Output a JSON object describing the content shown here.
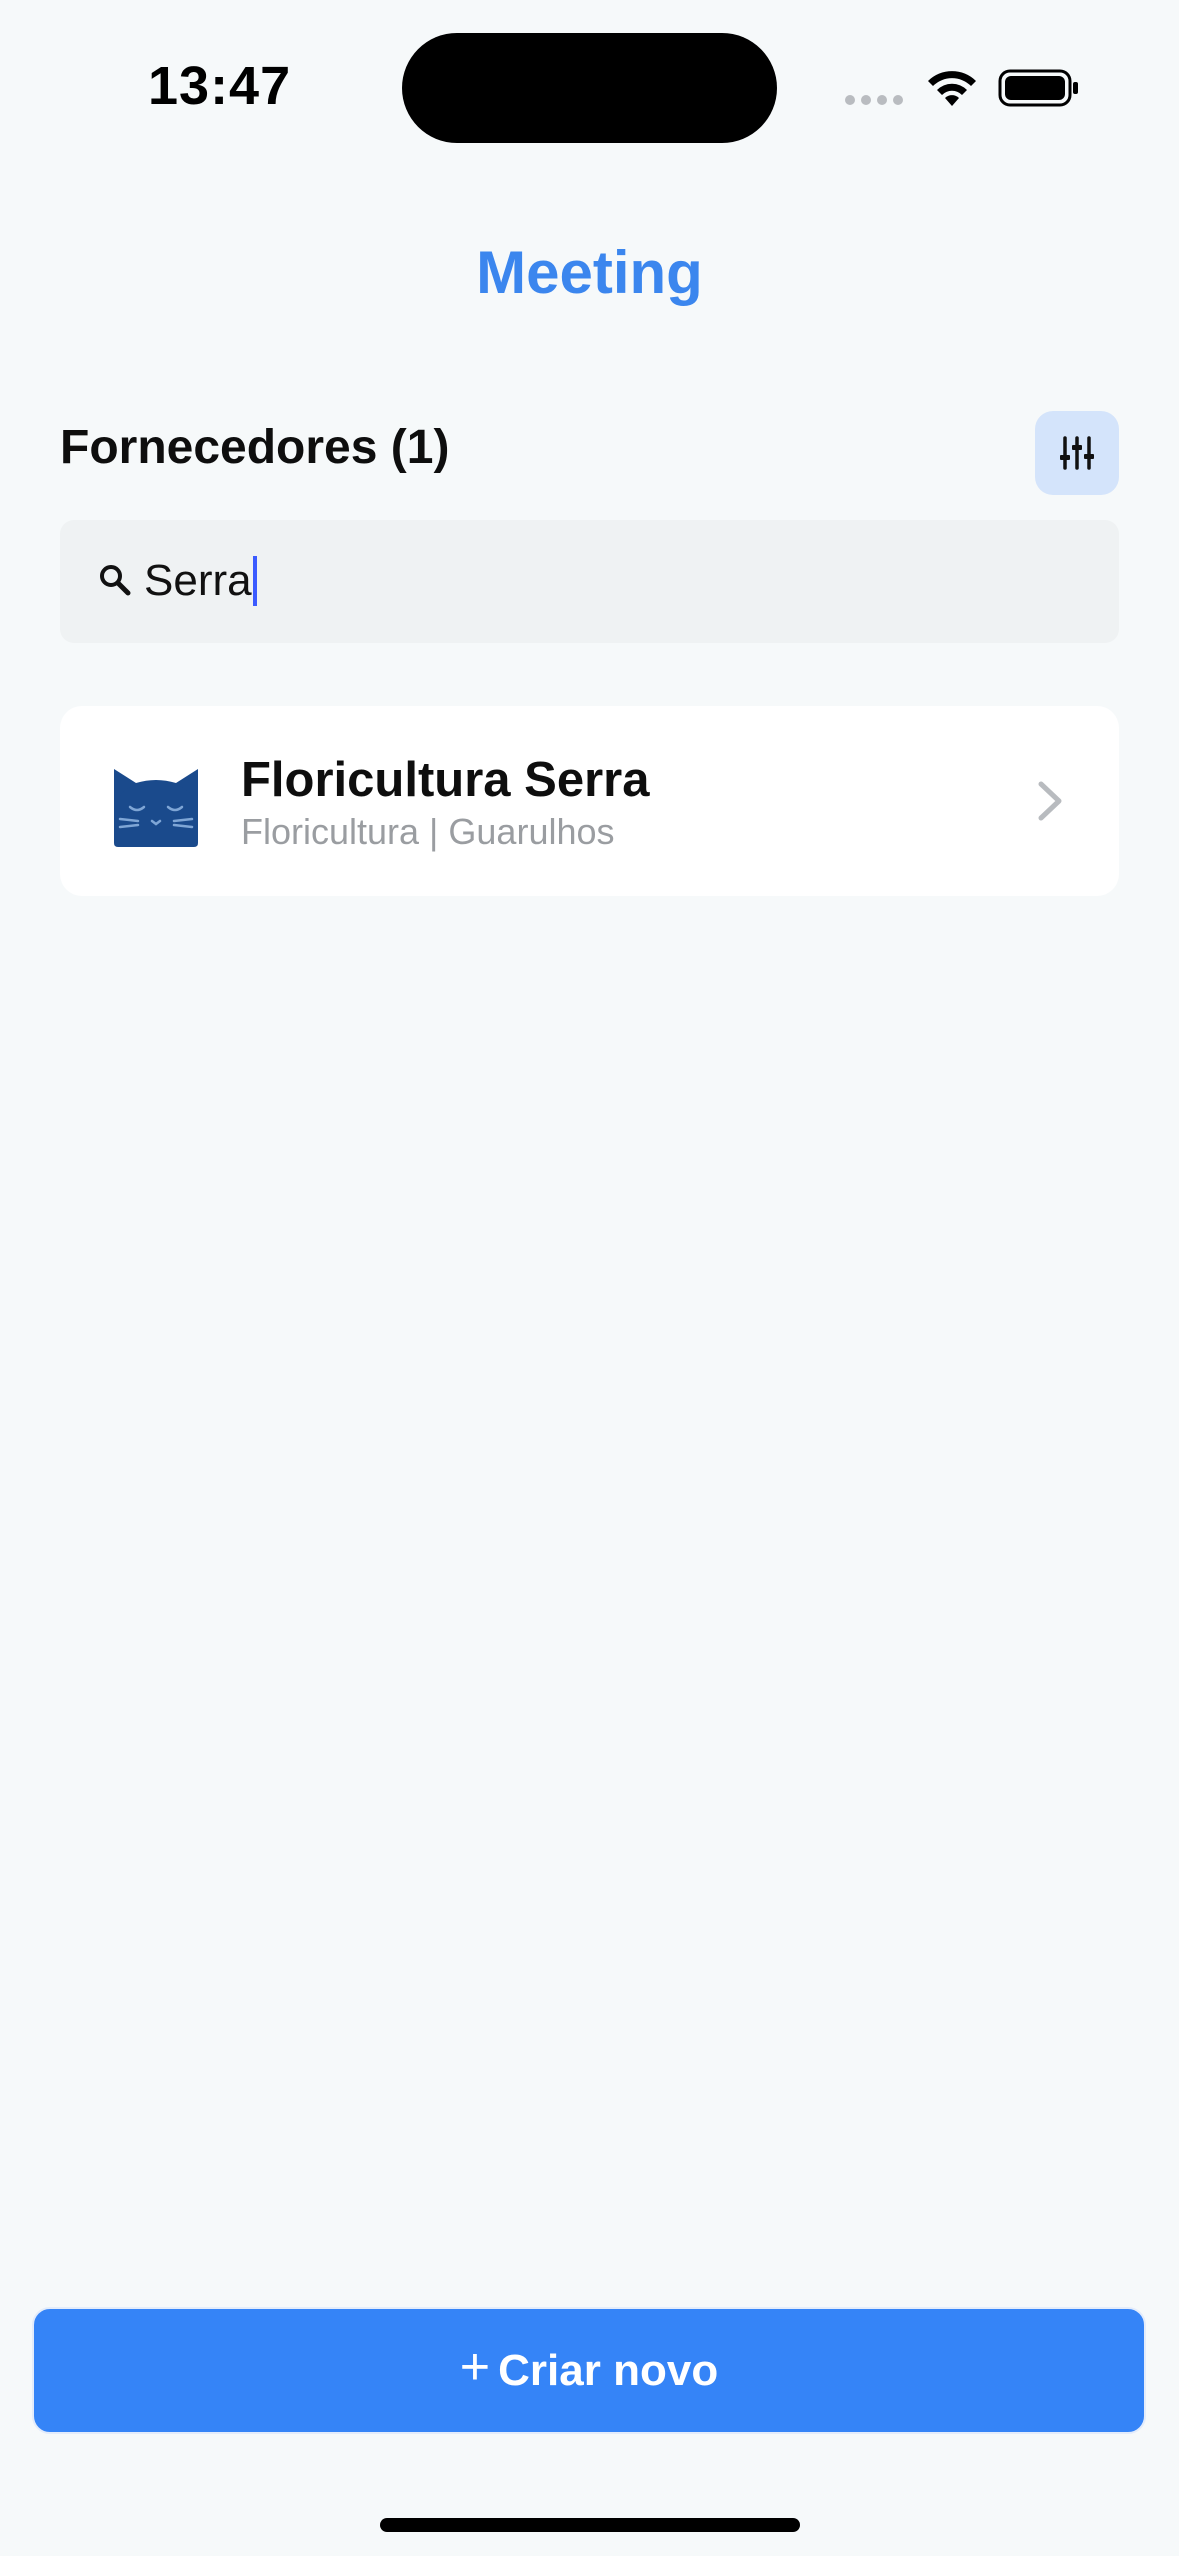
{
  "status_bar": {
    "time": "13:47"
  },
  "header": {
    "title": "Meeting"
  },
  "section": {
    "title": "Fornecedores (1)"
  },
  "search": {
    "value": "Serra",
    "icon": "search-icon"
  },
  "results": [
    {
      "name": "Floricultura Serra",
      "subtitle": "Floricultura | Guarulhos",
      "avatar_icon": "cat-face-icon"
    }
  ],
  "actions": {
    "create_plus": "+",
    "create_label": "Criar novo"
  },
  "colors": {
    "accent": "#3584f7",
    "title": "#3b86ee",
    "filter_bg": "#d4e4fb",
    "avatar": "#1a4a8c",
    "background": "#f6f9fa"
  }
}
